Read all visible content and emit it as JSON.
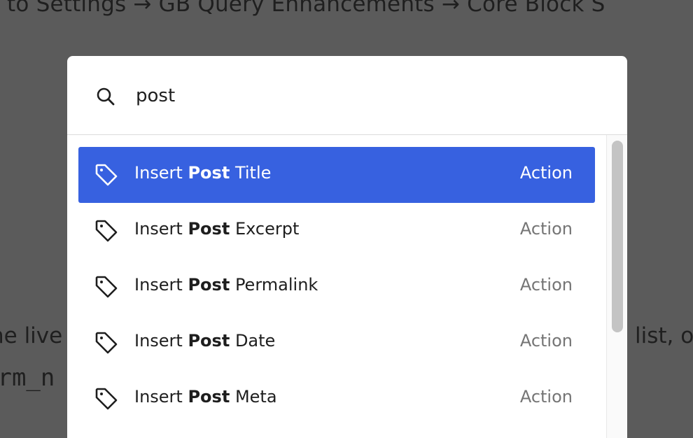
{
  "background": {
    "heading": "to Settings → GB Query Enhancements → Core Block S",
    "text_left": "he live",
    "text_right": "list, o",
    "code": "erm_n"
  },
  "palette": {
    "search": {
      "value": "post",
      "icon": "search-icon"
    },
    "results": [
      {
        "prefix": "Insert ",
        "match": "Post",
        "suffix": " Title",
        "type": "Action",
        "icon": "tag-icon",
        "selected": true
      },
      {
        "prefix": "Insert ",
        "match": "Post",
        "suffix": " Excerpt",
        "type": "Action",
        "icon": "tag-icon",
        "selected": false
      },
      {
        "prefix": "Insert ",
        "match": "Post",
        "suffix": " Permalink",
        "type": "Action",
        "icon": "tag-icon",
        "selected": false
      },
      {
        "prefix": "Insert ",
        "match": "Post",
        "suffix": " Date",
        "type": "Action",
        "icon": "tag-icon",
        "selected": false
      },
      {
        "prefix": "Insert ",
        "match": "Post",
        "suffix": " Meta",
        "type": "Action",
        "icon": "tag-icon",
        "selected": false
      }
    ]
  },
  "colors": {
    "overlay": "#5b5b5b",
    "accent": "#3761e0",
    "secondary_text": "#757575"
  }
}
